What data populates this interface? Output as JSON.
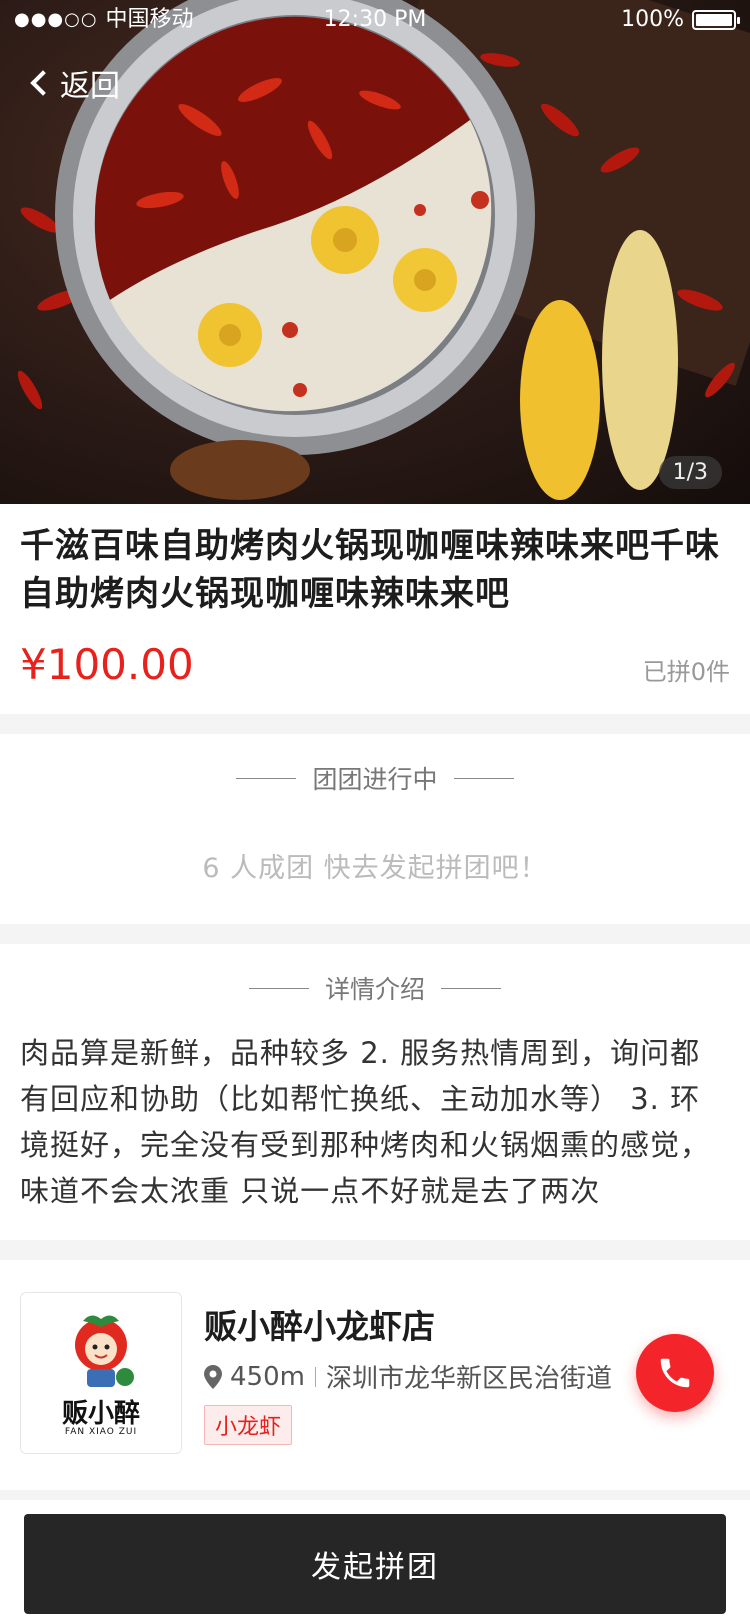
{
  "status_bar": {
    "signal": "●●●○○",
    "carrier": "中国移动",
    "time": "12:30 PM",
    "battery": "100%"
  },
  "nav": {
    "back_label": "返回"
  },
  "gallery": {
    "counter": "1/3"
  },
  "product": {
    "title": "千滋百味自助烤肉火锅现咖喱味辣味来吧千味自助烤肉火锅现咖喱味辣味来吧",
    "price": "¥100.00",
    "sold": "已拼0件"
  },
  "group_section": {
    "heading": "团团进行中",
    "hint": "6 人成团  快去发起拼团吧！"
  },
  "detail_section": {
    "heading": "详情介绍",
    "text": "肉品算是新鲜，品种较多 2. 服务热情周到，询问都有回应和协助（比如帮忙换纸、主动加水等） 3. 环境挺好，完全没有受到那种烤肉和火锅烟熏的感觉，味道不会太浓重 只说一点不好就是去了两次"
  },
  "shop": {
    "name": "贩小醉小龙虾店",
    "distance": "450m",
    "address": "深圳市龙华新区民治街道",
    "tag": "小龙虾",
    "logo_text": "贩小醉",
    "logo_subtext": "FAN XIAO ZUI"
  },
  "actions": {
    "start_group": "发起拼团"
  },
  "colors": {
    "accent": "#e8211c",
    "button_dark": "#262626",
    "call": "#f4252a"
  }
}
